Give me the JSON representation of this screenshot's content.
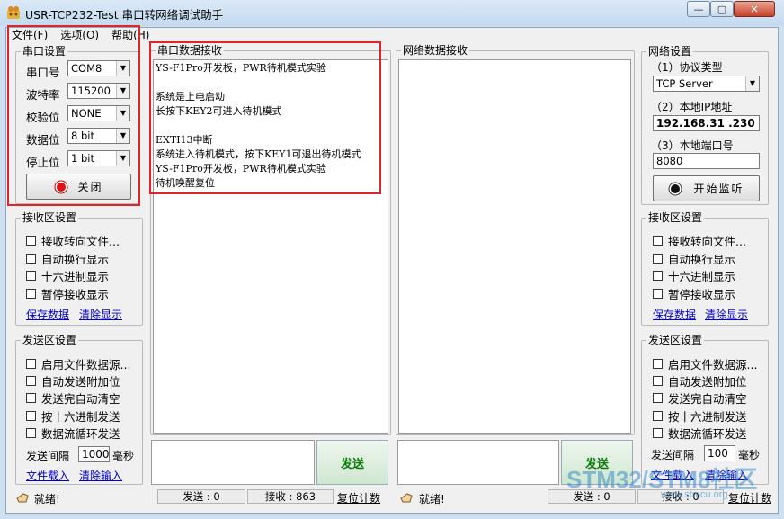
{
  "window": {
    "title": "USR-TCP232-Test 串口转网络调试助手",
    "min": "—",
    "max": "▢",
    "close": "✕"
  },
  "menu": [
    "文件(F)",
    "选项(O)",
    "帮助(H)"
  ],
  "serial_settings": {
    "title": "串口设置",
    "rows": [
      {
        "label": "串口号",
        "value": "COM8"
      },
      {
        "label": "波特率",
        "value": "115200"
      },
      {
        "label": "校验位",
        "value": "NONE"
      },
      {
        "label": "数据位",
        "value": "8 bit"
      },
      {
        "label": "停止位",
        "value": "1 bit"
      }
    ],
    "close_button": "关闭"
  },
  "recv_settings_left": {
    "title": "接收区设置",
    "options": [
      "接收转向文件...",
      "自动换行显示",
      "十六进制显示",
      "暂停接收显示"
    ],
    "save_link": "保存数据",
    "clear_link": "清除显示"
  },
  "send_settings_left": {
    "title": "发送区设置",
    "options": [
      "启用文件数据源...",
      "自动发送附加位",
      "发送完自动清空",
      "按十六进制发送",
      "数据流循环发送"
    ],
    "interval_label": "发送间隔",
    "interval_value": "1000",
    "interval_unit": "毫秒",
    "load_link": "文件载入",
    "clear_link": "清除输入"
  },
  "serial_recv": {
    "title": "串口数据接收",
    "lines": [
      "YS-F1Pro开发板，PWR待机模式实验",
      "",
      "系统是上电启动",
      "长按下KEY2可进入待机模式",
      "",
      " EXTI13中断",
      "系统进入待机模式，按下KEY1可退出待机模式",
      "YS-F1Pro开发板，PWR待机模式实验",
      "待机唤醒复位"
    ]
  },
  "net_recv": {
    "title": "网络数据接收"
  },
  "send_buttons": {
    "serial": "发送",
    "net": "发送"
  },
  "net_settings": {
    "title": "网络设置",
    "protocol_label": "（1）协议类型",
    "protocol_value": "TCP Server",
    "ip_label": "（2）本地IP地址",
    "ip_value": "192.168.31 .230",
    "port_label": "（3）本地端口号",
    "port_value": "8080",
    "listen_button": "开始监听"
  },
  "recv_settings_right": {
    "title": "接收区设置",
    "options": [
      "接收转向文件...",
      "自动换行显示",
      "十六进制显示",
      "暂停接收显示"
    ],
    "save_link": "保存数据",
    "clear_link": "清除显示"
  },
  "send_settings_right": {
    "title": "发送区设置",
    "options": [
      "启用文件数据源...",
      "自动发送附加位",
      "发送完自动清空",
      "按十六进制发送",
      "数据流循环发送"
    ],
    "interval_label": "发送间隔",
    "interval_value": "100",
    "interval_unit": "毫秒",
    "load_link": "文件载入",
    "clear_link": "清除输入"
  },
  "status_left": {
    "ready": "就绪!",
    "send": "发送 : 0",
    "recv": "接收 : 863",
    "reset": "复位计数"
  },
  "status_right": {
    "ready": "就绪!",
    "send": "发送 : 0",
    "recv": "接收 : 0",
    "reset": "复位计数"
  },
  "watermark": {
    "text": "STM32/STM8社区",
    "url": "www.stmcu.org"
  },
  "colors": {
    "highlight": "#e0252a",
    "link": "#0000cc",
    "send_text": "#0a7a0a"
  }
}
